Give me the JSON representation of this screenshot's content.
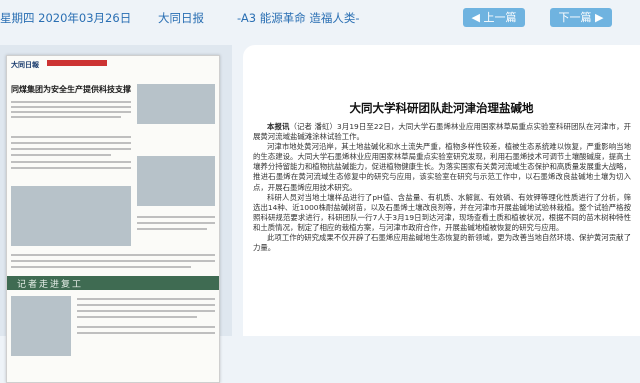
{
  "topbar": {
    "date": "星期四 2020年03月26日",
    "paper": "大同日报",
    "section": "-A3 能源革命 造福人类-",
    "prev": "上一篇",
    "next": "下一篇"
  },
  "thumbnail": {
    "masthead": "大同日報",
    "headline": "同煤集团为安全生产提供科技支撑",
    "banner": "记者走进复工"
  },
  "article": {
    "title": "大同大学科研团队赴河津治理盐碱地",
    "lead_bold": "本报讯",
    "lead": "（记者 潘虹）3月19日至22日，大同大学石墨烯林业应用国家林草局重点实验室科研团队在河津市，开展黄河流域盐碱滩涂林试验工作。",
    "p2": "河津市地处黄河沿岸，其土地盐碱化和水土流失严重，植物多样性较差，植被生态系统难以恢复，严重影响当地的生态建设。大同大学石墨烯林业应用国家林草局重点实验室研究发现，利用石墨烯技术可调节土壤酸碱度，提高土壤养分持留能力和植物抗盐碱能力，促进植物健康生长。为落实国家有关黄河流域生态保护和高质量发展重大战略，推进石墨烯在黄河流域生态修复中的研究与应用，该实验室在研究与示范工作中，以石墨烯改良盐碱地土壤为切入点，开展石墨烯应用技术研究。",
    "p3": "科研人员对当地土壤样品进行了pH值、含盐量、有机质、水解氮、有效磷、有效钾等理化性质进行了分析，筛选出14种、近1000株耐盐碱树苗，以及石墨烯土壤改良剂等，并在河津市开展盐碱地试验林栽植。整个试验严格按照科研规范要求进行，科研团队一行7人于3月19日到达河津，现场查看土质和植被状况，根据不同的苗木树种特性和土质情况，制定了相应的栽植方案，与河津市政府合作，开展盐碱地植被恢复的研究与应用。",
    "p4": "此项工作的研究成果不仅开辟了石墨烯应用盐碱地生态恢复的新领域，更为改善当地自然环境、保护黄河贡献了力量。"
  },
  "colors": {
    "accent": "#2a6fb3",
    "button": "#6fb3e0",
    "background": "#eef3f8"
  }
}
